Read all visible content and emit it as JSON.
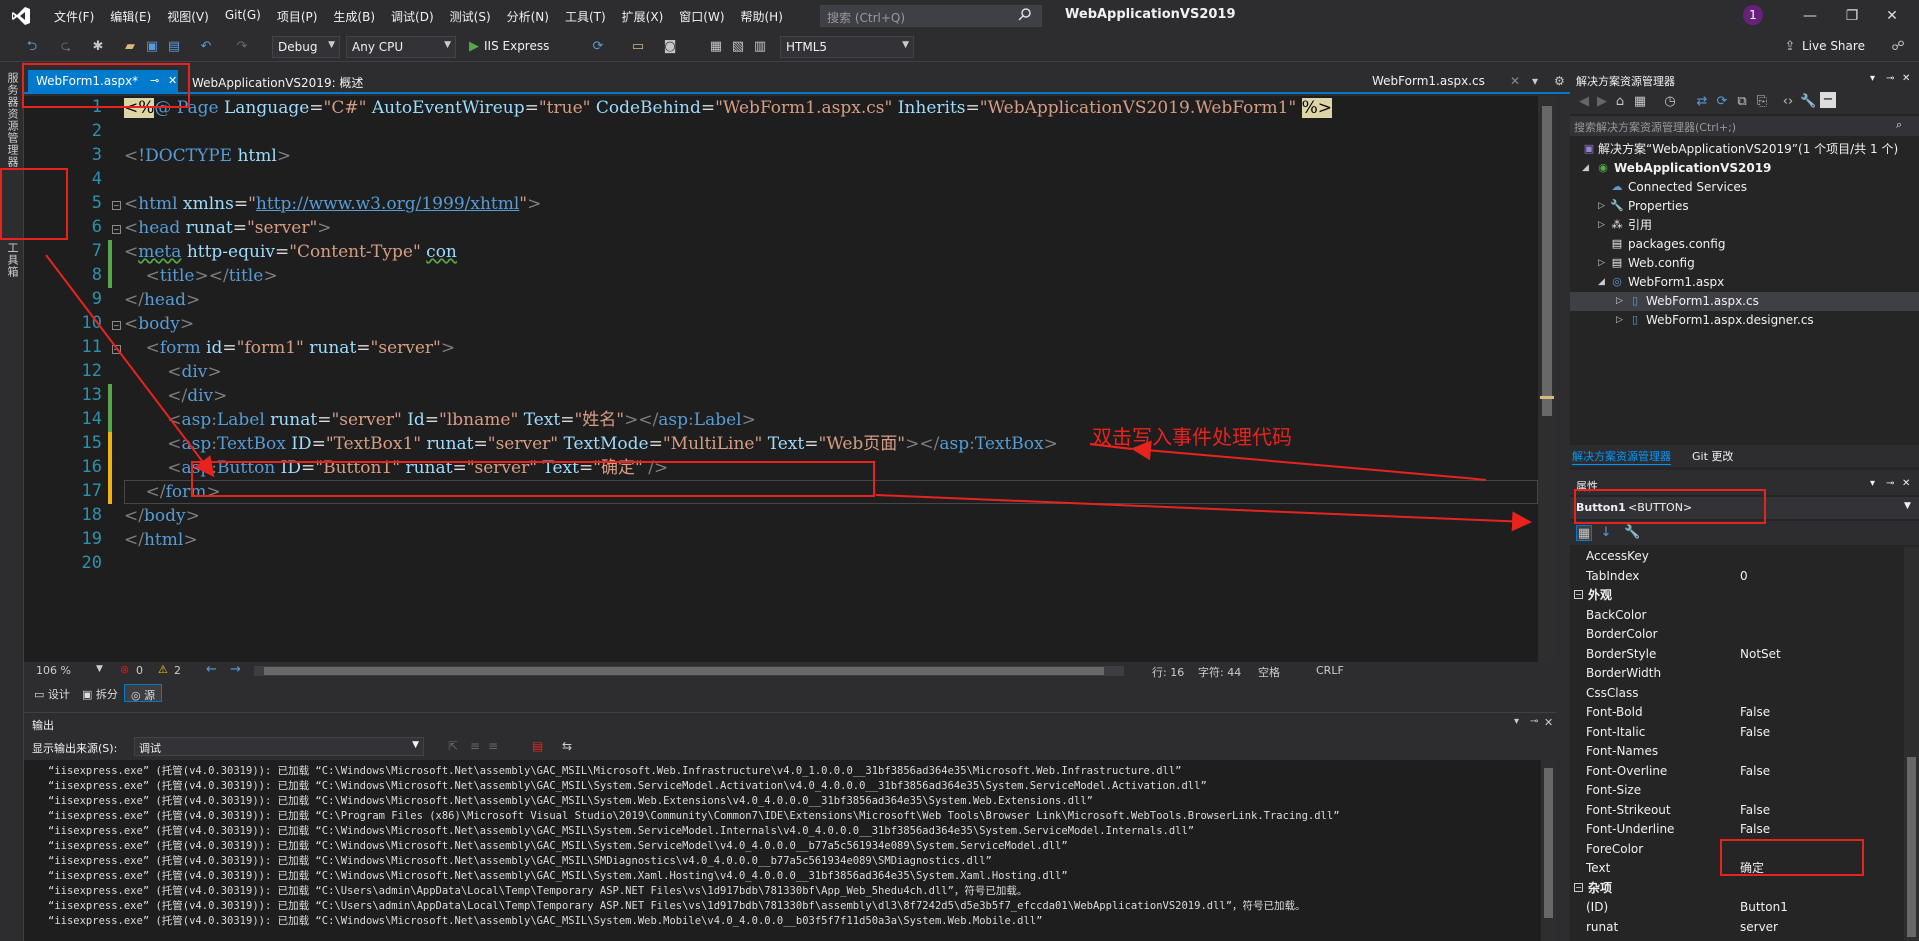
{
  "menubar": {
    "items": [
      "文件(F)",
      "编辑(E)",
      "视图(V)",
      "Git(G)",
      "项目(P)",
      "生成(B)",
      "调试(D)",
      "测试(S)",
      "分析(N)",
      "工具(T)",
      "扩展(X)",
      "窗口(W)",
      "帮助(H)"
    ],
    "search_placeholder": "搜索 (Ctrl+Q)",
    "solution_title": "WebApplicationVS2019",
    "notification_count": "1"
  },
  "toolbar": {
    "config": "Debug",
    "platform": "Any CPU",
    "run_target": "IIS Express",
    "doc_type": "HTML5",
    "live_share": "Live Share"
  },
  "left_strip": {
    "tab1": "服务器资源管理器",
    "tab2": "工具箱"
  },
  "tabs": {
    "active": "WebForm1.aspx*",
    "second": "WebApplicationVS2019: 概述",
    "right": "WebForm1.aspx.cs"
  },
  "code": {
    "line_numbers": [
      "1",
      "2",
      "3",
      "4",
      "5",
      "6",
      "7",
      "8",
      "9",
      "10",
      "11",
      "12",
      "13",
      "14",
      "15",
      "16",
      "17",
      "18",
      "19",
      "20"
    ]
  },
  "status": {
    "zoom": "106 %",
    "errors": "0",
    "warnings": "2",
    "line": "行: 16",
    "char": "字符: 44",
    "space": "空格",
    "eol": "CRLF"
  },
  "views": {
    "design": "设计",
    "split": "拆分",
    "source": "源"
  },
  "output": {
    "title": "输出",
    "source_label": "显示输出来源(S):",
    "source_value": "调试",
    "lines": [
      "“iisexpress.exe” (托管(v4.0.30319)): 已加载 “C:\\Windows\\Microsoft.Net\\assembly\\GAC_MSIL\\Microsoft.Web.Infrastructure\\v4.0_1.0.0.0__31bf3856ad364e35\\Microsoft.Web.Infrastructure.dll”",
      "“iisexpress.exe” (托管(v4.0.30319)): 已加载 “C:\\Windows\\Microsoft.Net\\assembly\\GAC_MSIL\\System.ServiceModel.Activation\\v4.0_4.0.0.0__31bf3856ad364e35\\System.ServiceModel.Activation.dll”",
      "“iisexpress.exe” (托管(v4.0.30319)): 已加载 “C:\\Windows\\Microsoft.Net\\assembly\\GAC_MSIL\\System.Web.Extensions\\v4.0_4.0.0.0__31bf3856ad364e35\\System.Web.Extensions.dll”",
      "“iisexpress.exe” (托管(v4.0.30319)): 已加载 “C:\\Program Files (x86)\\Microsoft Visual Studio\\2019\\Community\\Common7\\IDE\\Extensions\\Microsoft\\Web Tools\\Browser Link\\Microsoft.WebTools.BrowserLink.Tracing.dll”",
      "“iisexpress.exe” (托管(v4.0.30319)): 已加载 “C:\\Windows\\Microsoft.Net\\assembly\\GAC_MSIL\\System.ServiceModel.Internals\\v4.0_4.0.0.0__31bf3856ad364e35\\System.ServiceModel.Internals.dll”",
      "“iisexpress.exe” (托管(v4.0.30319)): 已加载 “C:\\Windows\\Microsoft.Net\\assembly\\GAC_MSIL\\System.ServiceModel\\v4.0_4.0.0.0__b77a5c561934e089\\System.ServiceModel.dll”",
      "“iisexpress.exe” (托管(v4.0.30319)): 已加载 “C:\\Windows\\Microsoft.Net\\assembly\\GAC_MSIL\\SMDiagnostics\\v4.0_4.0.0.0__b77a5c561934e089\\SMDiagnostics.dll”",
      "“iisexpress.exe” (托管(v4.0.30319)): 已加载 “C:\\Windows\\Microsoft.Net\\assembly\\GAC_MSIL\\System.Xaml.Hosting\\v4.0_4.0.0.0__31bf3856ad364e35\\System.Xaml.Hosting.dll”",
      "“iisexpress.exe” (托管(v4.0.30319)): 已加载 “C:\\Users\\admin\\AppData\\Local\\Temp\\Temporary ASP.NET Files\\vs\\1d917bdb\\781330bf\\App_Web_5hedu4ch.dll”，符号已加载。",
      "“iisexpress.exe” (托管(v4.0.30319)): 已加载 “C:\\Users\\admin\\AppData\\Local\\Temp\\Temporary ASP.NET Files\\vs\\1d917bdb\\781330bf\\assembly\\dl3\\8f7242d5\\d5e3b5f7_efccda01\\WebApplicationVS2019.dll”，符号已加载。",
      "“iisexpress.exe” (托管(v4.0.30319)): 已加载 “C:\\Windows\\Microsoft.Net\\assembly\\GAC_MSIL\\System.Web.Mobile\\v4.0_4.0.0.0__b03f5f7f11d50a3a\\System.Web.Mobile.dll”"
    ]
  },
  "solution_explorer": {
    "title": "解决方案资源管理器",
    "search_placeholder": "搜索解决方案资源管理器(Ctrl+;)",
    "solution": "解决方案“WebApplicationVS2019”(1 个项目/共 1 个)",
    "project": "WebApplicationVS2019",
    "items": [
      "Connected Services",
      "Properties",
      "引用",
      "packages.config",
      "Web.config",
      "WebForm1.aspx",
      "WebForm1.aspx.cs",
      "WebForm1.aspx.designer.cs"
    ],
    "tab1": "解决方案资源管理器",
    "tab2": "Git 更改"
  },
  "properties": {
    "title": "属性",
    "object_name": "Button1",
    "object_type": "<BUTTON>",
    "rows": [
      {
        "name": "AccessKey",
        "value": ""
      },
      {
        "name": "TabIndex",
        "value": "0"
      }
    ],
    "cat_appearance": "外观",
    "appearance": [
      {
        "name": "BackColor",
        "value": ""
      },
      {
        "name": "BorderColor",
        "value": ""
      },
      {
        "name": "BorderStyle",
        "value": "NotSet"
      },
      {
        "name": "BorderWidth",
        "value": ""
      },
      {
        "name": "CssClass",
        "value": ""
      },
      {
        "name": "Font-Bold",
        "value": "False"
      },
      {
        "name": "Font-Italic",
        "value": "False"
      },
      {
        "name": "Font-Names",
        "value": ""
      },
      {
        "name": "Font-Overline",
        "value": "False"
      },
      {
        "name": "Font-Size",
        "value": ""
      },
      {
        "name": "Font-Strikeout",
        "value": "False"
      },
      {
        "name": "Font-Underline",
        "value": "False"
      },
      {
        "name": "ForeColor",
        "value": ""
      },
      {
        "name": "Text",
        "value": "确定"
      }
    ],
    "cat_misc": "杂项",
    "misc": [
      {
        "name": "(ID)",
        "value": "Button1"
      },
      {
        "name": "runat",
        "value": "server"
      }
    ]
  },
  "annotation": "双击写入事件处理代码",
  "colors": {
    "accent": "#007acc",
    "annotation": "#e8231e",
    "background": "#1e1e1e"
  }
}
